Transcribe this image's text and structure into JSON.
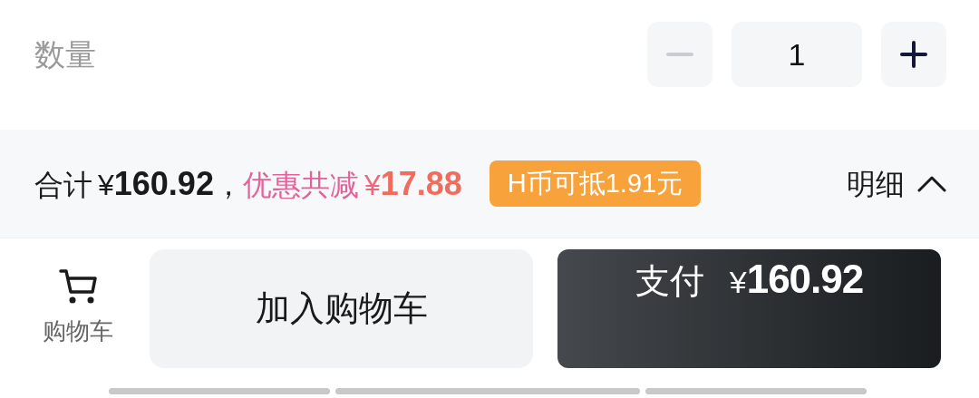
{
  "quantity": {
    "label": "数量",
    "value": "1",
    "decrease_disabled": true,
    "increase_disabled": false
  },
  "summary": {
    "total_label": "合计",
    "total_currency": "¥",
    "total_amount": "160.92",
    "separator": "，",
    "discount_label": "优惠共减",
    "discount_currency": "¥",
    "discount_amount": "17.88",
    "coin_badge": "H币可抵1.91元",
    "details_label": "明细",
    "details_expanded": true
  },
  "actions": {
    "cart_label": "购物车",
    "add_to_cart": "加入购物车",
    "pay_label": "支付",
    "pay_currency": "¥",
    "pay_amount": "160.92"
  }
}
